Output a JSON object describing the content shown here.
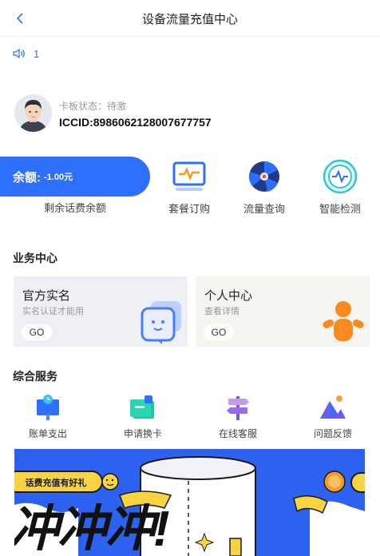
{
  "header": {
    "title": "设备流量充值中心",
    "back_icon": "chevron-left-icon"
  },
  "notice": {
    "icon": "speaker-icon",
    "text": "1"
  },
  "card": {
    "status": "卡板状态：待激",
    "iccid": "ICCID:898606212800767775​7"
  },
  "balance": {
    "label": "余额:",
    "value": "-1.00元",
    "caption": "剩余话费余额"
  },
  "tools": [
    {
      "label": "套餐订购",
      "icon": "monitor-pulse-icon"
    },
    {
      "label": "流量查询",
      "icon": "fan-icon"
    },
    {
      "label": "智能检测",
      "icon": "detect-icon"
    }
  ],
  "business": {
    "title": "业务中心",
    "cards": [
      {
        "name": "官方实名",
        "desc": "实名认证才能用",
        "go": "GO",
        "icon": "chat-face-icon"
      },
      {
        "name": "个人中心",
        "desc": "查看详情",
        "go": "GO",
        "icon": "person-icon"
      }
    ]
  },
  "services": {
    "title": "综合服务",
    "items": [
      {
        "label": "账单支出",
        "icon": "bill-clock-icon"
      },
      {
        "label": "申请换卡",
        "icon": "sim-card-icon"
      },
      {
        "label": "在线客服",
        "icon": "signpost-icon"
      },
      {
        "label": "问题反馈",
        "icon": "mountain-icon"
      }
    ]
  },
  "banner": {
    "tag": "话费充值有好礼",
    "headline": "冲冲冲!",
    "colors": {
      "bg": "#2c62ef",
      "accent": "#f8d443"
    }
  },
  "colors": {
    "brand": "#2f6fff",
    "card1_bg": "#eef0f6",
    "card2_bg": "#f6f4ef"
  }
}
